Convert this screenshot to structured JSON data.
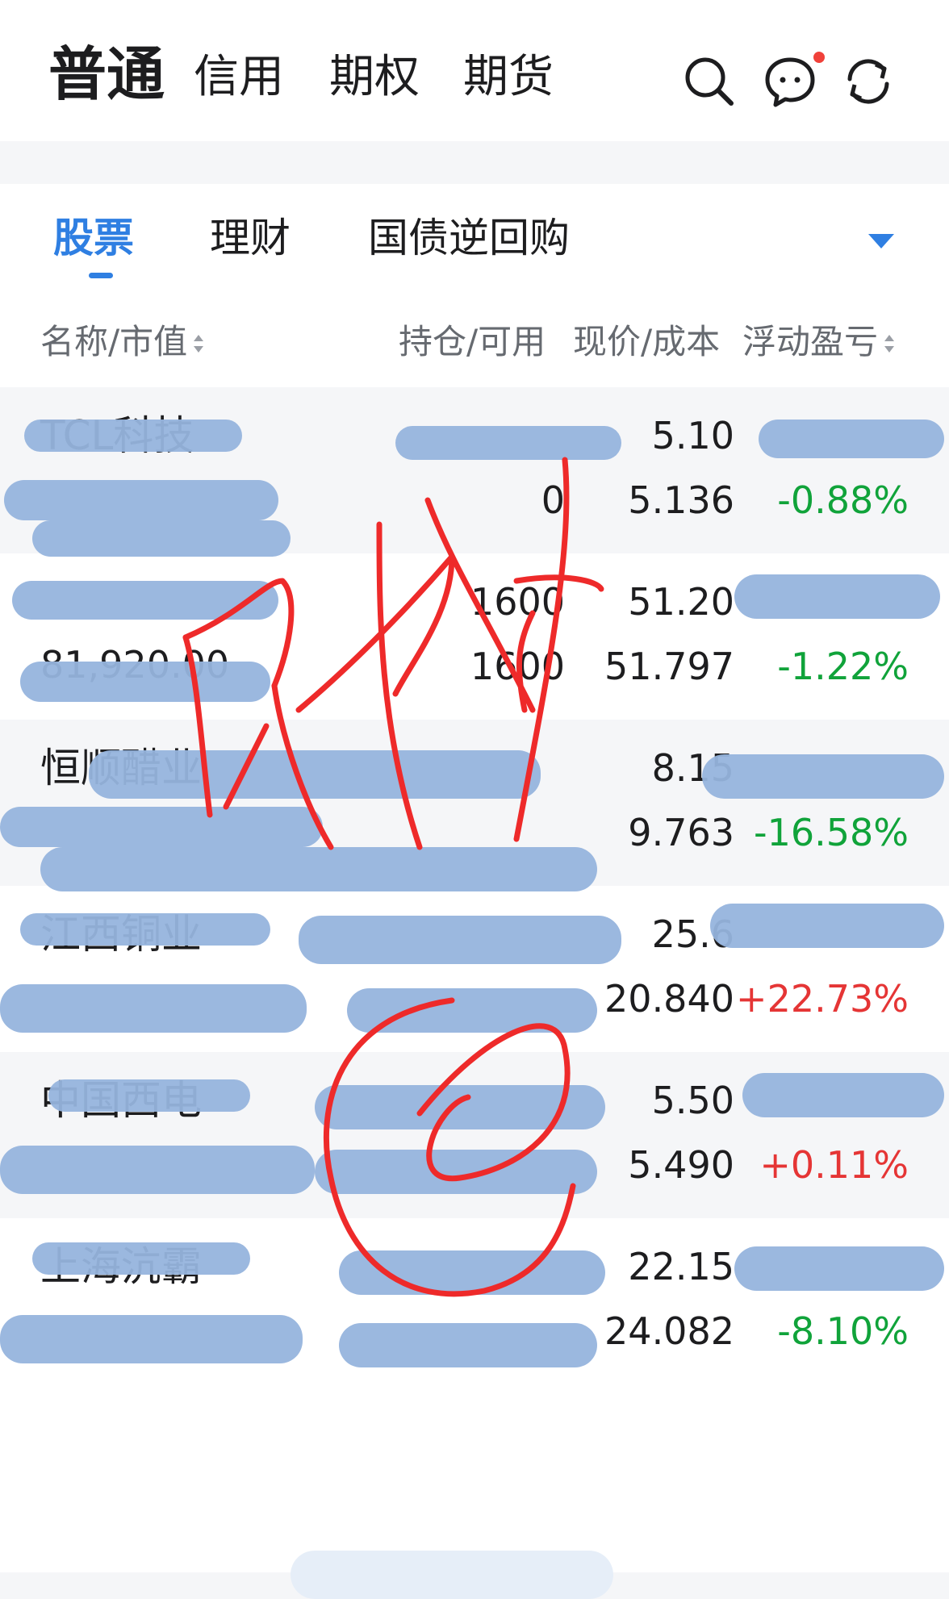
{
  "top_tabs": [
    "普通",
    "信用",
    "期权",
    "期货"
  ],
  "sub_tabs": [
    "股票",
    "理财",
    "国债逆回购"
  ],
  "headers": {
    "name": "名称/市值",
    "position": "持仓/可用",
    "price": "现价/成本",
    "pnl": "浮动盈亏"
  },
  "icons": {
    "search": "search-icon",
    "message": "chat-icon",
    "refresh": "refresh-icon",
    "dropdown": "chevron-down-icon"
  },
  "colors": {
    "accent": "#2f7fe2",
    "down": "#10a33a",
    "up": "#e53535",
    "scribble": "#96b4dd",
    "handwriting": "#ee2a2a"
  },
  "rows": [
    {
      "name": "TCL科技",
      "market_value": "",
      "qty": "",
      "available": "0",
      "price": "5.10",
      "cost": "5.136",
      "pnl": "",
      "pct": "-0.88%",
      "dir": "down"
    },
    {
      "name": "",
      "market_value": "81,920.00",
      "qty": "1600",
      "available": "1600",
      "price": "51.20",
      "cost": "51.797",
      "pnl": "",
      "pct": "-1.22%",
      "dir": "down"
    },
    {
      "name": "恒顺醋业",
      "market_value": "",
      "qty": "",
      "available": "",
      "price": "8.15",
      "cost": "9.763",
      "pnl": "",
      "pct": "-16.58%",
      "dir": "down"
    },
    {
      "name": "江西铜业",
      "market_value": "",
      "qty": "",
      "available": "",
      "price": "25.6",
      "cost": "20.840",
      "pnl": "",
      "pct": "+22.73%",
      "dir": "up"
    },
    {
      "name": "中国西电",
      "market_value": "",
      "qty": "",
      "available": "",
      "price": "5.50",
      "cost": "5.490",
      "pnl": "",
      "pct": "+0.11%",
      "dir": "up"
    },
    {
      "name": "上海沆霸",
      "market_value": "",
      "qty": "",
      "available": "",
      "price": "22.15",
      "cost": "24.082",
      "pnl": "",
      "pct": "-8.10%",
      "dir": "down"
    }
  ]
}
